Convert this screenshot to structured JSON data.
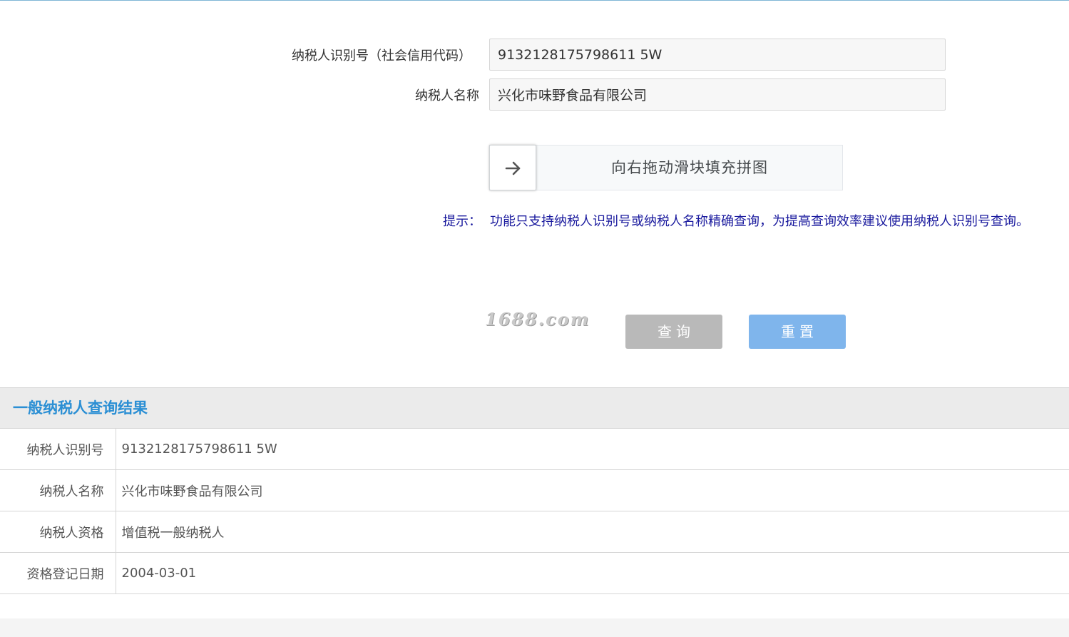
{
  "form": {
    "taxpayer_id_label": "纳税人识别号（社会信用代码）",
    "taxpayer_id_value": "9132128175798611 5W",
    "taxpayer_name_label": "纳税人名称",
    "taxpayer_name_value": "兴化市味野食品有限公司"
  },
  "slider": {
    "handle_icon": "arrow-right-icon",
    "instruction": "向右拖动滑块填充拼图"
  },
  "hint": {
    "label": "提示：",
    "text": "功能只支持纳税人识别号或纳税人名称精确查询，为提高查询效率建议使用纳税人识别号查询。"
  },
  "watermark": "1688.com",
  "buttons": {
    "query": "查询",
    "reset": "重置"
  },
  "colors": {
    "query_button": "#b9b9b9",
    "reset_button": "#7fb5ec",
    "result_title": "#2b8fd4",
    "hint_text": "#1a1a9e"
  },
  "result": {
    "title": "一般纳税人查询结果",
    "rows": [
      {
        "label": "纳税人识别号",
        "value": "9132128175798611 5W"
      },
      {
        "label": "纳税人名称",
        "value": "兴化市味野食品有限公司"
      },
      {
        "label": "纳税人资格",
        "value": "增值税一般纳税人"
      },
      {
        "label": "资格登记日期",
        "value": "2004-03-01"
      }
    ]
  }
}
